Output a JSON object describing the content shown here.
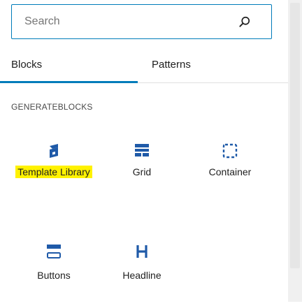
{
  "search": {
    "placeholder": "Search",
    "value": ""
  },
  "tabs": [
    {
      "label": "Blocks",
      "active": true
    },
    {
      "label": "Patterns",
      "active": false
    }
  ],
  "category": {
    "title": "GENERATEBLOCKS"
  },
  "blocks": [
    {
      "label": "Template Library",
      "icon": "generateblocks-logo-icon",
      "highlighted": true
    },
    {
      "label": "Grid",
      "icon": "grid-icon"
    },
    {
      "label": "Container",
      "icon": "container-icon"
    },
    {
      "label": "Buttons",
      "icon": "buttons-icon"
    },
    {
      "label": "Headline",
      "icon": "headline-icon"
    }
  ],
  "colors": {
    "accent": "#007cba",
    "highlight": "#fff200",
    "icon": "#1f5aa8"
  }
}
